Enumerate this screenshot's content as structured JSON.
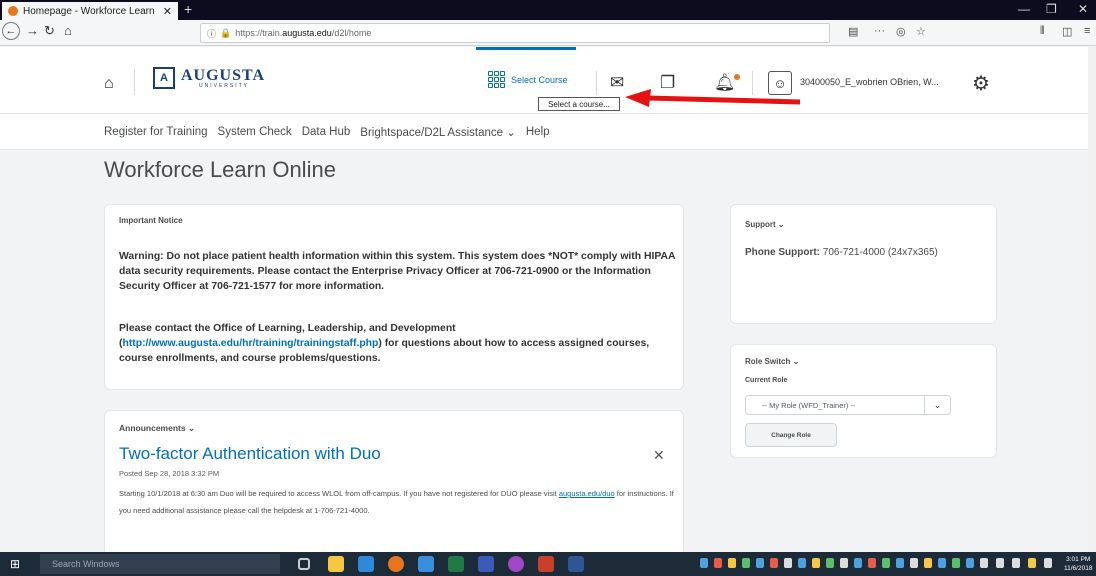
{
  "browser": {
    "tab_title": "Homepage - Workforce Learn",
    "tab_close": "✕",
    "new_tab": "+",
    "url_prefix": "https://train.",
    "url_domain": "augusta.edu",
    "url_path": "/d2l/home",
    "url_actions": "···",
    "window_controls": [
      "—",
      "❐",
      "✕"
    ]
  },
  "header": {
    "logo_main": "AUGUSTA",
    "logo_sub": "UNIVERSITY",
    "select_course": "Select Course",
    "tooltip": "Select a course...",
    "username": "30400050_E_wobrien OBrien, W...",
    "accent_color": "#006fbf"
  },
  "nav": {
    "links": [
      "Register for Training",
      "System Check",
      "Data Hub",
      "Brightspace/D2L Assistance ⌄",
      "Help"
    ]
  },
  "page": {
    "title": "Workforce Learn Online"
  },
  "notice": {
    "heading": "Important Notice",
    "warning": "Warning: Do not place patient health information within this system. This system does *NOT* comply with HIPAA data security requirements. Please contact the Enterprise Privacy Officer at 706-721-0900 or the Information Security Officer at 706-721-1577 for more information.",
    "contact_pre": "Please contact the Office of Learning, Leadership, and Development (",
    "contact_link": "http://www.augusta.edu/hr/training/trainingstaff.php",
    "contact_post": ") for questions about how to access assigned courses, course enrollments, and course problems/questions."
  },
  "announcements": {
    "heading": "Announcements ⌄",
    "item_title": "Two-factor Authentication with Duo",
    "close": "✕",
    "posted": "Posted Sep 28, 2018 3:32 PM",
    "body_1": "Starting 10/1/2018  at 6:30 am Duo will be required to access WLOL from off-campus.  If you have not registered for DUO please visit ",
    "body_link": "augusta.edu/duo",
    "body_2": " for instructions.  If you need additional assistance please call the helpdesk at 1-706-721-4000."
  },
  "support": {
    "heading": "Support ⌄",
    "phone_label": "Phone Support:",
    "phone_value": " 706-721-4000 (24x7x365)"
  },
  "role_switch": {
    "heading": "Role Switch ⌄",
    "current_label": "Current Role",
    "selected": "-- My Role (WFD_Trainer) --",
    "button": "Change Role"
  },
  "taskbar": {
    "search_placeholder": "Search Windows",
    "time": "3:01 PM",
    "date": "11/6/2018"
  }
}
